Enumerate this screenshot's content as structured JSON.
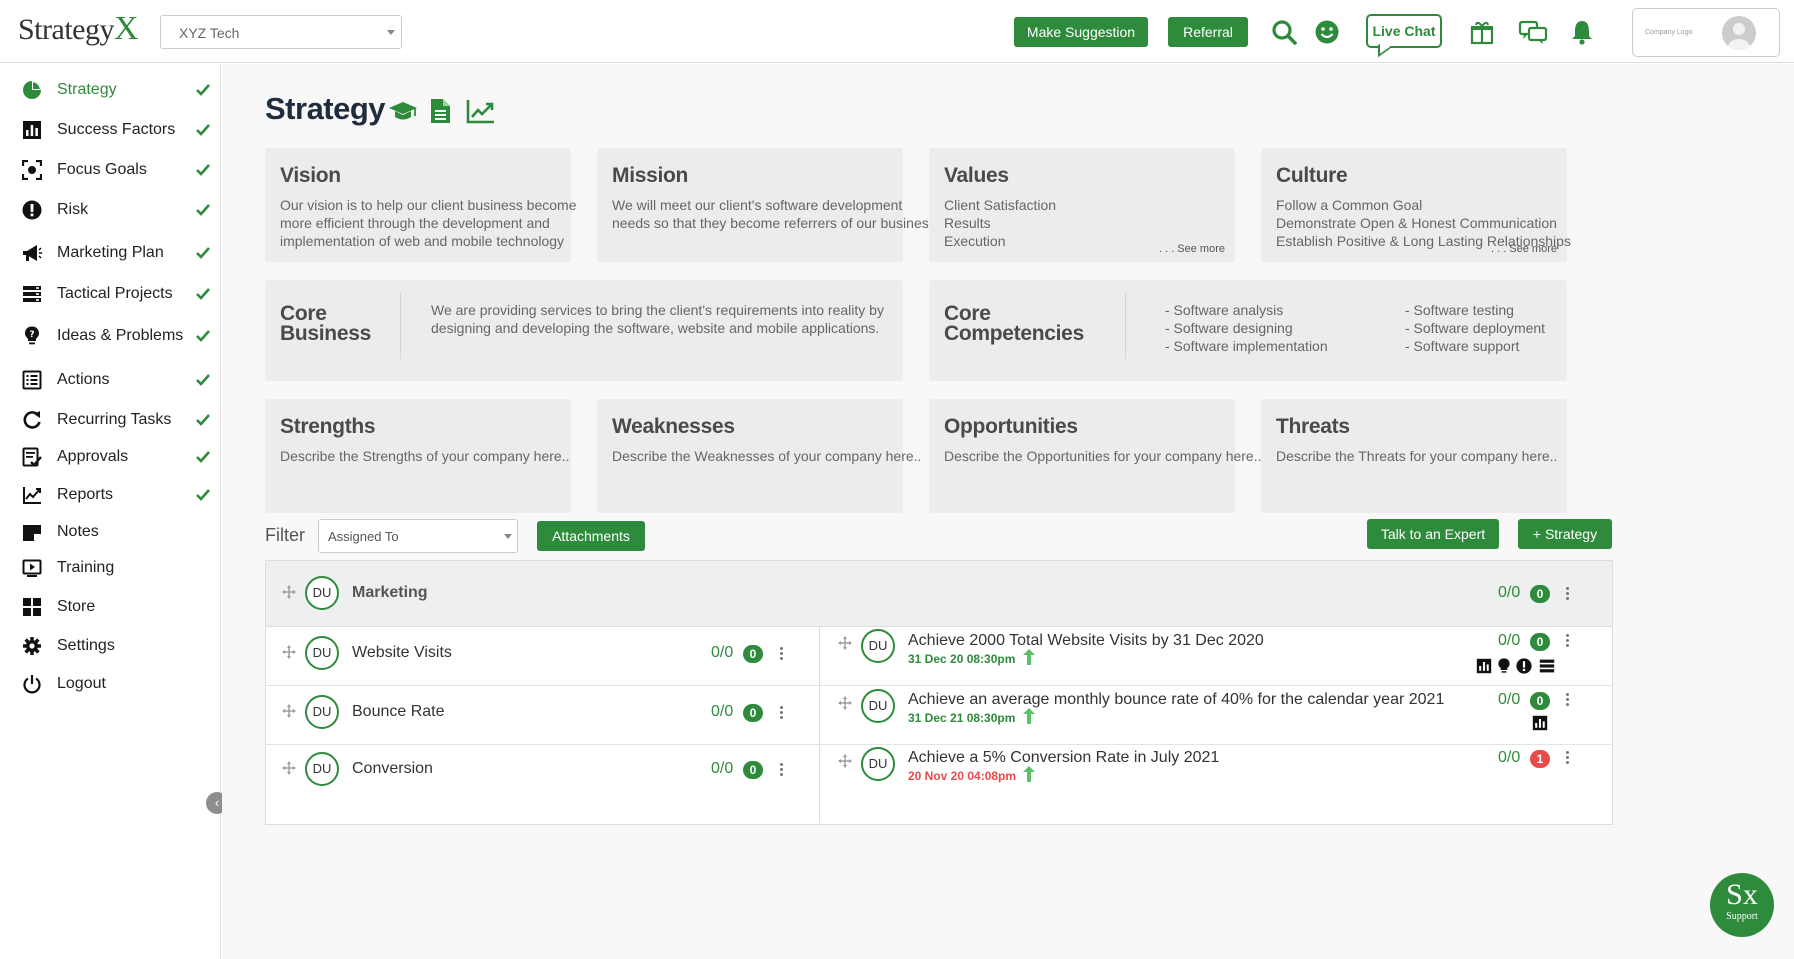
{
  "brand": {
    "logo_main": "Strategy",
    "logo_accent": "X"
  },
  "header": {
    "company_select_value": "XYZ Tech",
    "make_suggestion": "Make Suggestion",
    "referral": "Referral",
    "live_chat": "Live Chat",
    "company_logo_text": "Company Logo"
  },
  "sidebar": {
    "items": [
      {
        "label": "Strategy",
        "icon": "pie-chart-icon",
        "checked": true
      },
      {
        "label": "Success Factors",
        "icon": "bar-chart-icon",
        "checked": true
      },
      {
        "label": "Focus Goals",
        "icon": "target-icon",
        "checked": true
      },
      {
        "label": "Risk",
        "icon": "alert-icon",
        "checked": true
      },
      {
        "label": "Marketing Plan",
        "icon": "megaphone-icon",
        "checked": true
      },
      {
        "label": "Tactical Projects",
        "icon": "server-icon",
        "checked": true
      },
      {
        "label": "Ideas & Problems",
        "icon": "question-bulb-icon",
        "checked": true
      },
      {
        "label": "Actions",
        "icon": "list-icon",
        "checked": true
      },
      {
        "label": "Recurring Tasks",
        "icon": "refresh-icon",
        "checked": true
      },
      {
        "label": "Approvals",
        "icon": "checklist-icon",
        "checked": true
      },
      {
        "label": "Reports",
        "icon": "line-chart-icon",
        "checked": true
      },
      {
        "label": "Notes",
        "icon": "note-icon",
        "checked": false
      },
      {
        "label": "Training",
        "icon": "play-icon",
        "checked": false
      },
      {
        "label": "Store",
        "icon": "grid-icon",
        "checked": false
      },
      {
        "label": "Settings",
        "icon": "gear-icon",
        "checked": false
      },
      {
        "label": "Logout",
        "icon": "power-icon",
        "checked": false
      }
    ]
  },
  "page": {
    "title": "Strategy"
  },
  "cards": {
    "vision": {
      "title": "Vision",
      "lines": [
        "Our vision is to help our client business become",
        "more efficient through the development and",
        "implementation of web and mobile technology"
      ]
    },
    "mission": {
      "title": "Mission",
      "lines": [
        "We will meet our client's software development",
        "needs so that they become referrers of our business."
      ]
    },
    "values": {
      "title": "Values",
      "lines": [
        "Client Satisfaction",
        "Results",
        "Execution"
      ],
      "see_more": ". . . See more"
    },
    "culture": {
      "title": "Culture",
      "lines": [
        "Follow a Common Goal",
        "Demonstrate Open & Honest Communication",
        "Establish Positive & Long Lasting Relationships"
      ],
      "see_more": ". . . See more"
    },
    "core_business": {
      "title_line1": "Core",
      "title_line2": "Business",
      "lines": [
        "We are providing services to bring the client's requirements into reality by",
        "designing and developing the software, website and mobile applications."
      ]
    },
    "core_competencies": {
      "title_line1": "Core",
      "title_line2": "Competencies",
      "col1": [
        "- Software analysis",
        "- Software designing",
        "- Software implementation"
      ],
      "col2": [
        "- Software testing",
        "- Software deployment",
        "- Software support"
      ]
    },
    "strengths": {
      "title": "Strengths",
      "text": "Describe the Strengths of your company here.."
    },
    "weaknesses": {
      "title": "Weaknesses",
      "text": "Describe the Weaknesses of your company here.."
    },
    "opportunities": {
      "title": "Opportunities",
      "text": "Describe the Opportunities for your company here.."
    },
    "threats": {
      "title": "Threats",
      "text": "Describe the Threats for your company here.."
    }
  },
  "filter": {
    "label": "Filter",
    "select_value": "Assigned To",
    "attachments": "Attachments",
    "talk_expert": "Talk to an Expert",
    "add_strategy": "+ Strategy"
  },
  "table": {
    "group": {
      "initials": "DU",
      "name": "Marketing",
      "ratio": "0/0",
      "badge": "0"
    },
    "rows": [
      {
        "initials": "DU",
        "name": "Website Visits",
        "ratio": "0/0",
        "badge": "0",
        "goal": {
          "initials": "DU",
          "title": "Achieve 2000 Total Website Visits by 31 Dec 2020",
          "date": "31 Dec 20 08:30pm",
          "ratio": "0/0",
          "badge": "0",
          "overdue": false
        }
      },
      {
        "initials": "DU",
        "name": "Bounce Rate",
        "ratio": "0/0",
        "badge": "0",
        "goal": {
          "initials": "DU",
          "title": "Achieve an average monthly bounce rate of 40% for the calendar year 2021",
          "date": "31 Dec 21 08:30pm",
          "ratio": "0/0",
          "badge": "0",
          "overdue": false
        }
      },
      {
        "initials": "DU",
        "name": "Conversion",
        "ratio": "0/0",
        "badge": "0",
        "goal": {
          "initials": "DU",
          "title": "Achieve a 5% Conversion Rate in July 2021",
          "date": "20 Nov 20 04:08pm",
          "ratio": "0/0",
          "badge": "1",
          "overdue": true
        }
      }
    ]
  },
  "support": {
    "logo": "Sx",
    "label": "Support"
  },
  "colors": {
    "accent": "#2e8b3c",
    "danger": "#e84b4b",
    "title": "#1f2c3c"
  }
}
